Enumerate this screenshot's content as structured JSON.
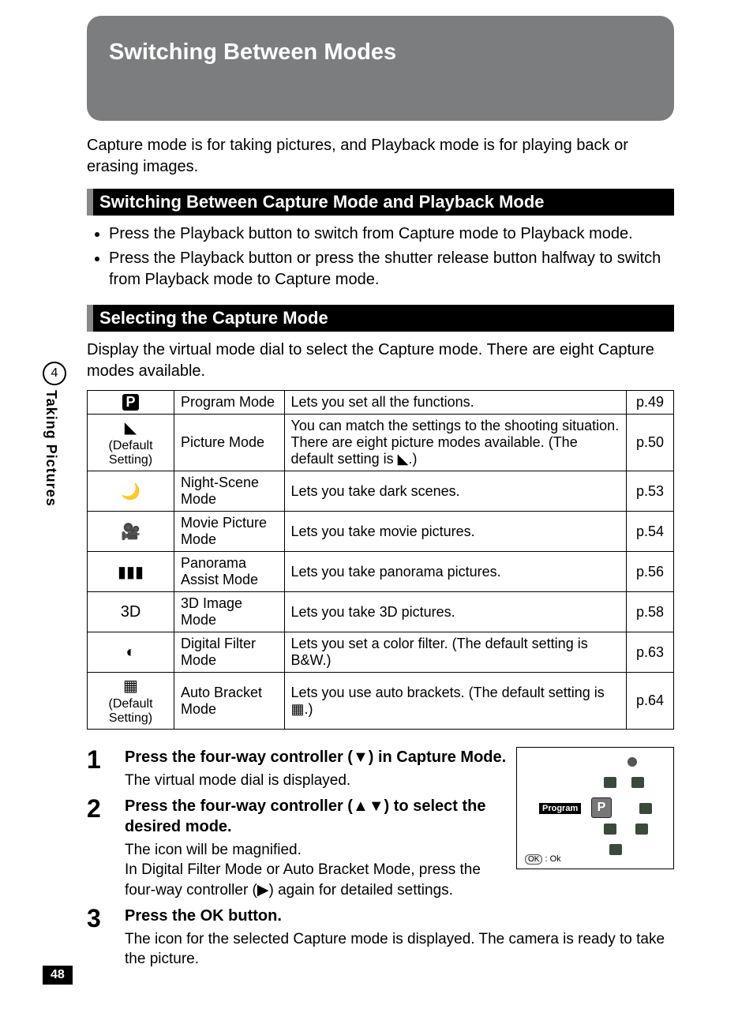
{
  "title": "Switching Between Modes",
  "intro": "Capture mode is for taking pictures, and Playback mode is for playing back or erasing images.",
  "section1": {
    "heading": "Switching Between Capture Mode and Playback Mode",
    "bullets": [
      "Press the Playback button to switch from Capture mode to Playback mode.",
      "Press the Playback button or press the shutter release button halfway to switch from Playback mode to Capture mode."
    ]
  },
  "section2": {
    "heading": "Selecting the Capture Mode",
    "lead": "Display the virtual mode dial to select the Capture mode. There are eight Capture modes available."
  },
  "modes": [
    {
      "icon_glyph": "P",
      "icon_sub": "",
      "name": "Program Mode",
      "desc": "Lets you set all the functions.",
      "page": "p.49"
    },
    {
      "icon_glyph": "◣",
      "icon_sub": "(Default Setting)",
      "name": "Picture Mode",
      "desc": "You can match the settings to the shooting situation. There are eight picture modes available. (The default setting is ◣.)",
      "page": "p.50"
    },
    {
      "icon_glyph": "🌙",
      "icon_sub": "",
      "name": "Night-Scene Mode",
      "desc": "Lets you take dark scenes.",
      "page": "p.53"
    },
    {
      "icon_glyph": "🎥",
      "icon_sub": "",
      "name": "Movie Picture Mode",
      "desc": "Lets you take movie pictures.",
      "page": "p.54"
    },
    {
      "icon_glyph": "▮▮▮",
      "icon_sub": "",
      "name": "Panorama Assist Mode",
      "desc": "Lets you take panorama pictures.",
      "page": "p.56"
    },
    {
      "icon_glyph": "3D",
      "icon_sub": "",
      "name": "3D Image Mode",
      "desc": "Lets you take 3D pictures.",
      "page": "p.58"
    },
    {
      "icon_glyph": "◐",
      "icon_sub": "",
      "name": "Digital Filter Mode",
      "desc": "Lets you set a color filter. (The default setting is B&W.)",
      "page": "p.63"
    },
    {
      "icon_glyph": "▦",
      "icon_sub": "(Default Setting)",
      "name": "Auto Bracket Mode",
      "desc": "Lets you use auto brackets. (The default setting is ▦.)",
      "page": "p.64"
    }
  ],
  "steps": [
    {
      "num": "1",
      "title": "Press the four-way controller (▼) in Capture Mode.",
      "text": "The virtual mode dial is displayed."
    },
    {
      "num": "2",
      "title": "Press the four-way controller (▲▼) to select the desired mode.",
      "text": "The icon will be magnified.\nIn Digital Filter Mode or Auto Bracket Mode, press the four-way controller (▶) again for detailed settings."
    },
    {
      "num": "3",
      "title": "Press the OK button.",
      "text": "The icon for the selected Capture mode is displayed. The camera is ready to take the picture."
    }
  ],
  "dial": {
    "label": "Program",
    "center": "P",
    "ok": "OK : Ok"
  },
  "side": {
    "chapter": "4",
    "label": "Taking Pictures"
  },
  "page_number": "48"
}
